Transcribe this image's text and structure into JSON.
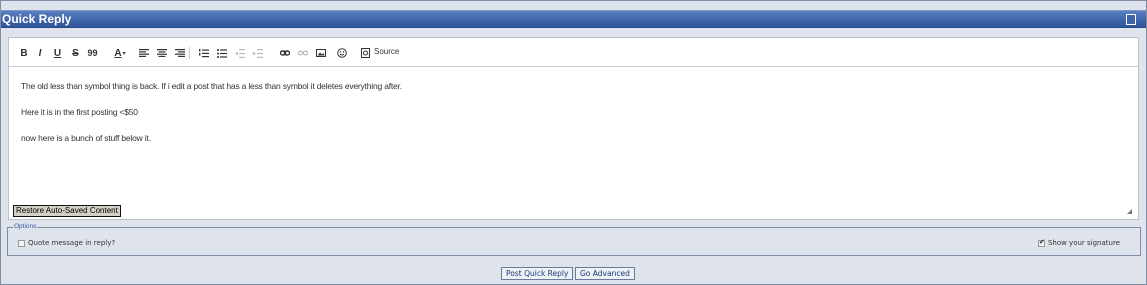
{
  "panel": {
    "title": "Quick Reply"
  },
  "toolbar": {
    "bold": "B",
    "italic": "I",
    "underline": "U",
    "strike": "S",
    "quote": "99",
    "font_color": "A",
    "source_label": "Source"
  },
  "editor": {
    "lines": [
      "The old less than symbol thing is back. If i edit a post that has a less than symbol it deletes everything after.",
      "Here it is in the first posting <$50",
      "now here is a bunch of stuff below it."
    ],
    "restore_label": "Restore Auto-Saved Content"
  },
  "options": {
    "legend": "Options",
    "quote_message": {
      "label": "Quote message in reply?",
      "checked": false
    },
    "show_signature": {
      "label": "Show your signature",
      "checked": true
    }
  },
  "actions": {
    "post_label": "Post Quick Reply",
    "advanced_label": "Go Advanced"
  }
}
